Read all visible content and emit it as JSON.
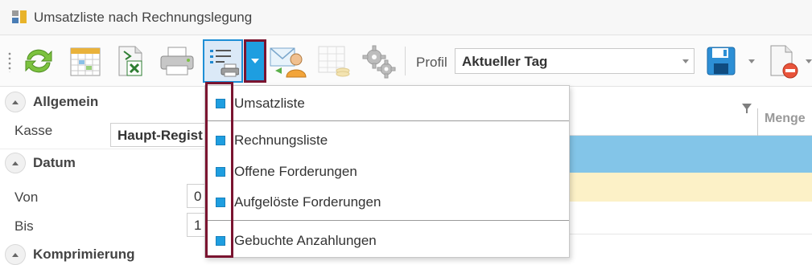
{
  "window": {
    "title": "Umsatzliste nach Rechnungslegung"
  },
  "toolbar": {
    "buttons": [
      {
        "icon": "refresh-icon"
      },
      {
        "icon": "calendar-icon"
      },
      {
        "icon": "excel-export-icon"
      },
      {
        "icon": "printer-icon"
      },
      {
        "icon": "report-list-print-icon",
        "selected": true
      },
      {
        "icon": "email-contact-icon"
      },
      {
        "icon": "table-icon"
      },
      {
        "icon": "settings-gear-icon"
      },
      {
        "icon": "save-disk-icon"
      },
      {
        "icon": "delete-document-icon"
      }
    ],
    "profil_label": "Profil",
    "profil_value": "Aktueller Tag"
  },
  "left_panel": {
    "sections": [
      {
        "title": "Allgemein"
      },
      {
        "title": "Datum"
      },
      {
        "title": "Komprimierung"
      }
    ],
    "kasse_label": "Kasse",
    "kasse_value": "Haupt-Regist",
    "von_label": "Von",
    "von_value": "0",
    "bis_label": "Bis",
    "bis_value": "1"
  },
  "grid": {
    "col_header": "Menge"
  },
  "menu": {
    "items": [
      {
        "label": "Umsatzliste",
        "checked": true
      },
      {
        "label": "Rechnungsliste",
        "checked": true
      },
      {
        "label": "Offene Forderungen",
        "checked": true
      },
      {
        "label": "Aufgelöste Forderungen",
        "checked": true
      },
      {
        "label": "Gebuchte Anzahlungen",
        "checked": true
      }
    ]
  },
  "colors": {
    "accent": "#1e9ee0",
    "highlight_border": "#7a1430",
    "selected_row": "#83c5e8",
    "yellow_row": "#fcf1c7"
  }
}
